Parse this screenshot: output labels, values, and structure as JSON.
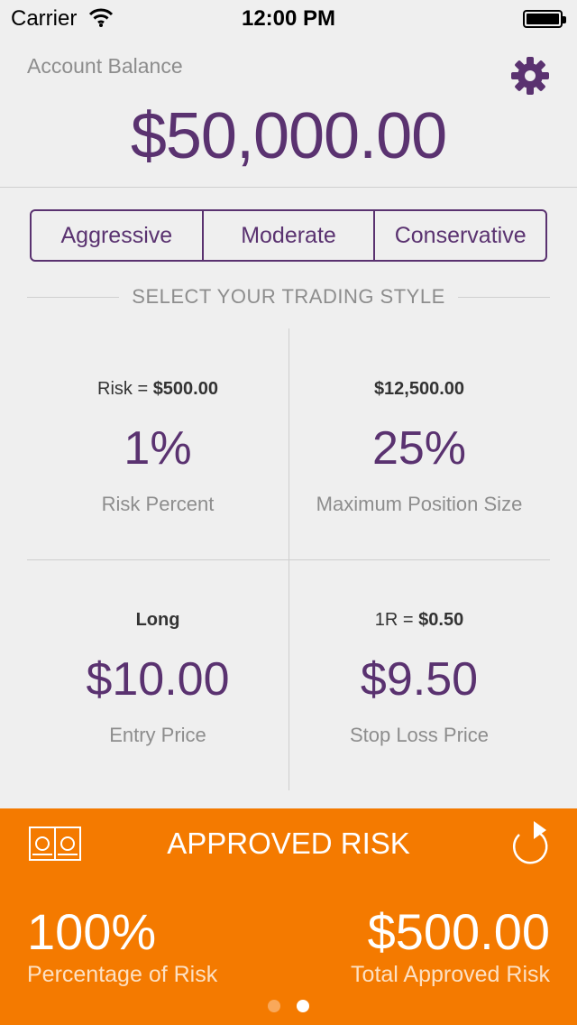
{
  "status_bar": {
    "carrier": "Carrier",
    "time": "12:00 PM",
    "icons": [
      "wifi-icon",
      "battery-icon"
    ]
  },
  "header": {
    "balance_label": "Account Balance",
    "balance_value": "$50,000.00",
    "settings_icon": "gear-icon"
  },
  "trading_styles": {
    "options": [
      "Aggressive",
      "Moderate",
      "Conservative"
    ],
    "heading": "SELECT YOUR TRADING STYLE"
  },
  "metrics": {
    "risk": {
      "top_prefix": "Risk = ",
      "top_value": "$500.00",
      "value": "1%",
      "caption": "Risk Percent"
    },
    "position": {
      "top_value": "$12,500.00",
      "value": "25%",
      "caption": "Maximum Position Size"
    },
    "entry": {
      "top_value": "Long",
      "value": "$10.00",
      "caption": "Entry Price"
    },
    "stop": {
      "top_prefix": "1R = ",
      "top_value": "$0.50",
      "value": "$9.50",
      "caption": "Stop Loss Price"
    }
  },
  "approved_risk": {
    "title": "APPROVED RISK",
    "percentage": "100%",
    "percentage_label": "Percentage of Risk",
    "total": "$500.00",
    "total_label": "Total Approved Risk",
    "icons": [
      "money-icon",
      "refresh-icon"
    ],
    "page_count": 2,
    "active_page": 2
  },
  "colors": {
    "accent_purple": "#5a3270",
    "panel_orange": "#f47a00",
    "background": "#efefef"
  }
}
